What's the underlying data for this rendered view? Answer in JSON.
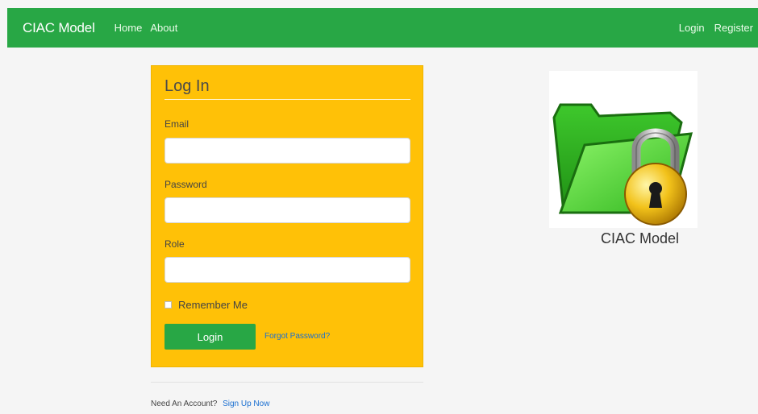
{
  "navbar": {
    "brand": "CIAC Model",
    "links": [
      "Home",
      "About"
    ],
    "right_links": [
      "Login",
      "Register"
    ]
  },
  "login_form": {
    "title": "Log In",
    "email_label": "Email",
    "email_value": "",
    "password_label": "Password",
    "password_value": "",
    "role_label": "Role",
    "role_value": "",
    "remember_label": "Remember Me",
    "login_button": "Login",
    "forgot_link": "Forgot Password?"
  },
  "signup": {
    "prompt": "Need An Account?",
    "link": "Sign Up Now"
  },
  "logo": {
    "caption": "CIAC Model",
    "icon": "folder-lock-icon"
  },
  "colors": {
    "navbar": "#28a745",
    "card": "#ffc107",
    "button": "#28a745",
    "link": "#1a6fd1"
  }
}
